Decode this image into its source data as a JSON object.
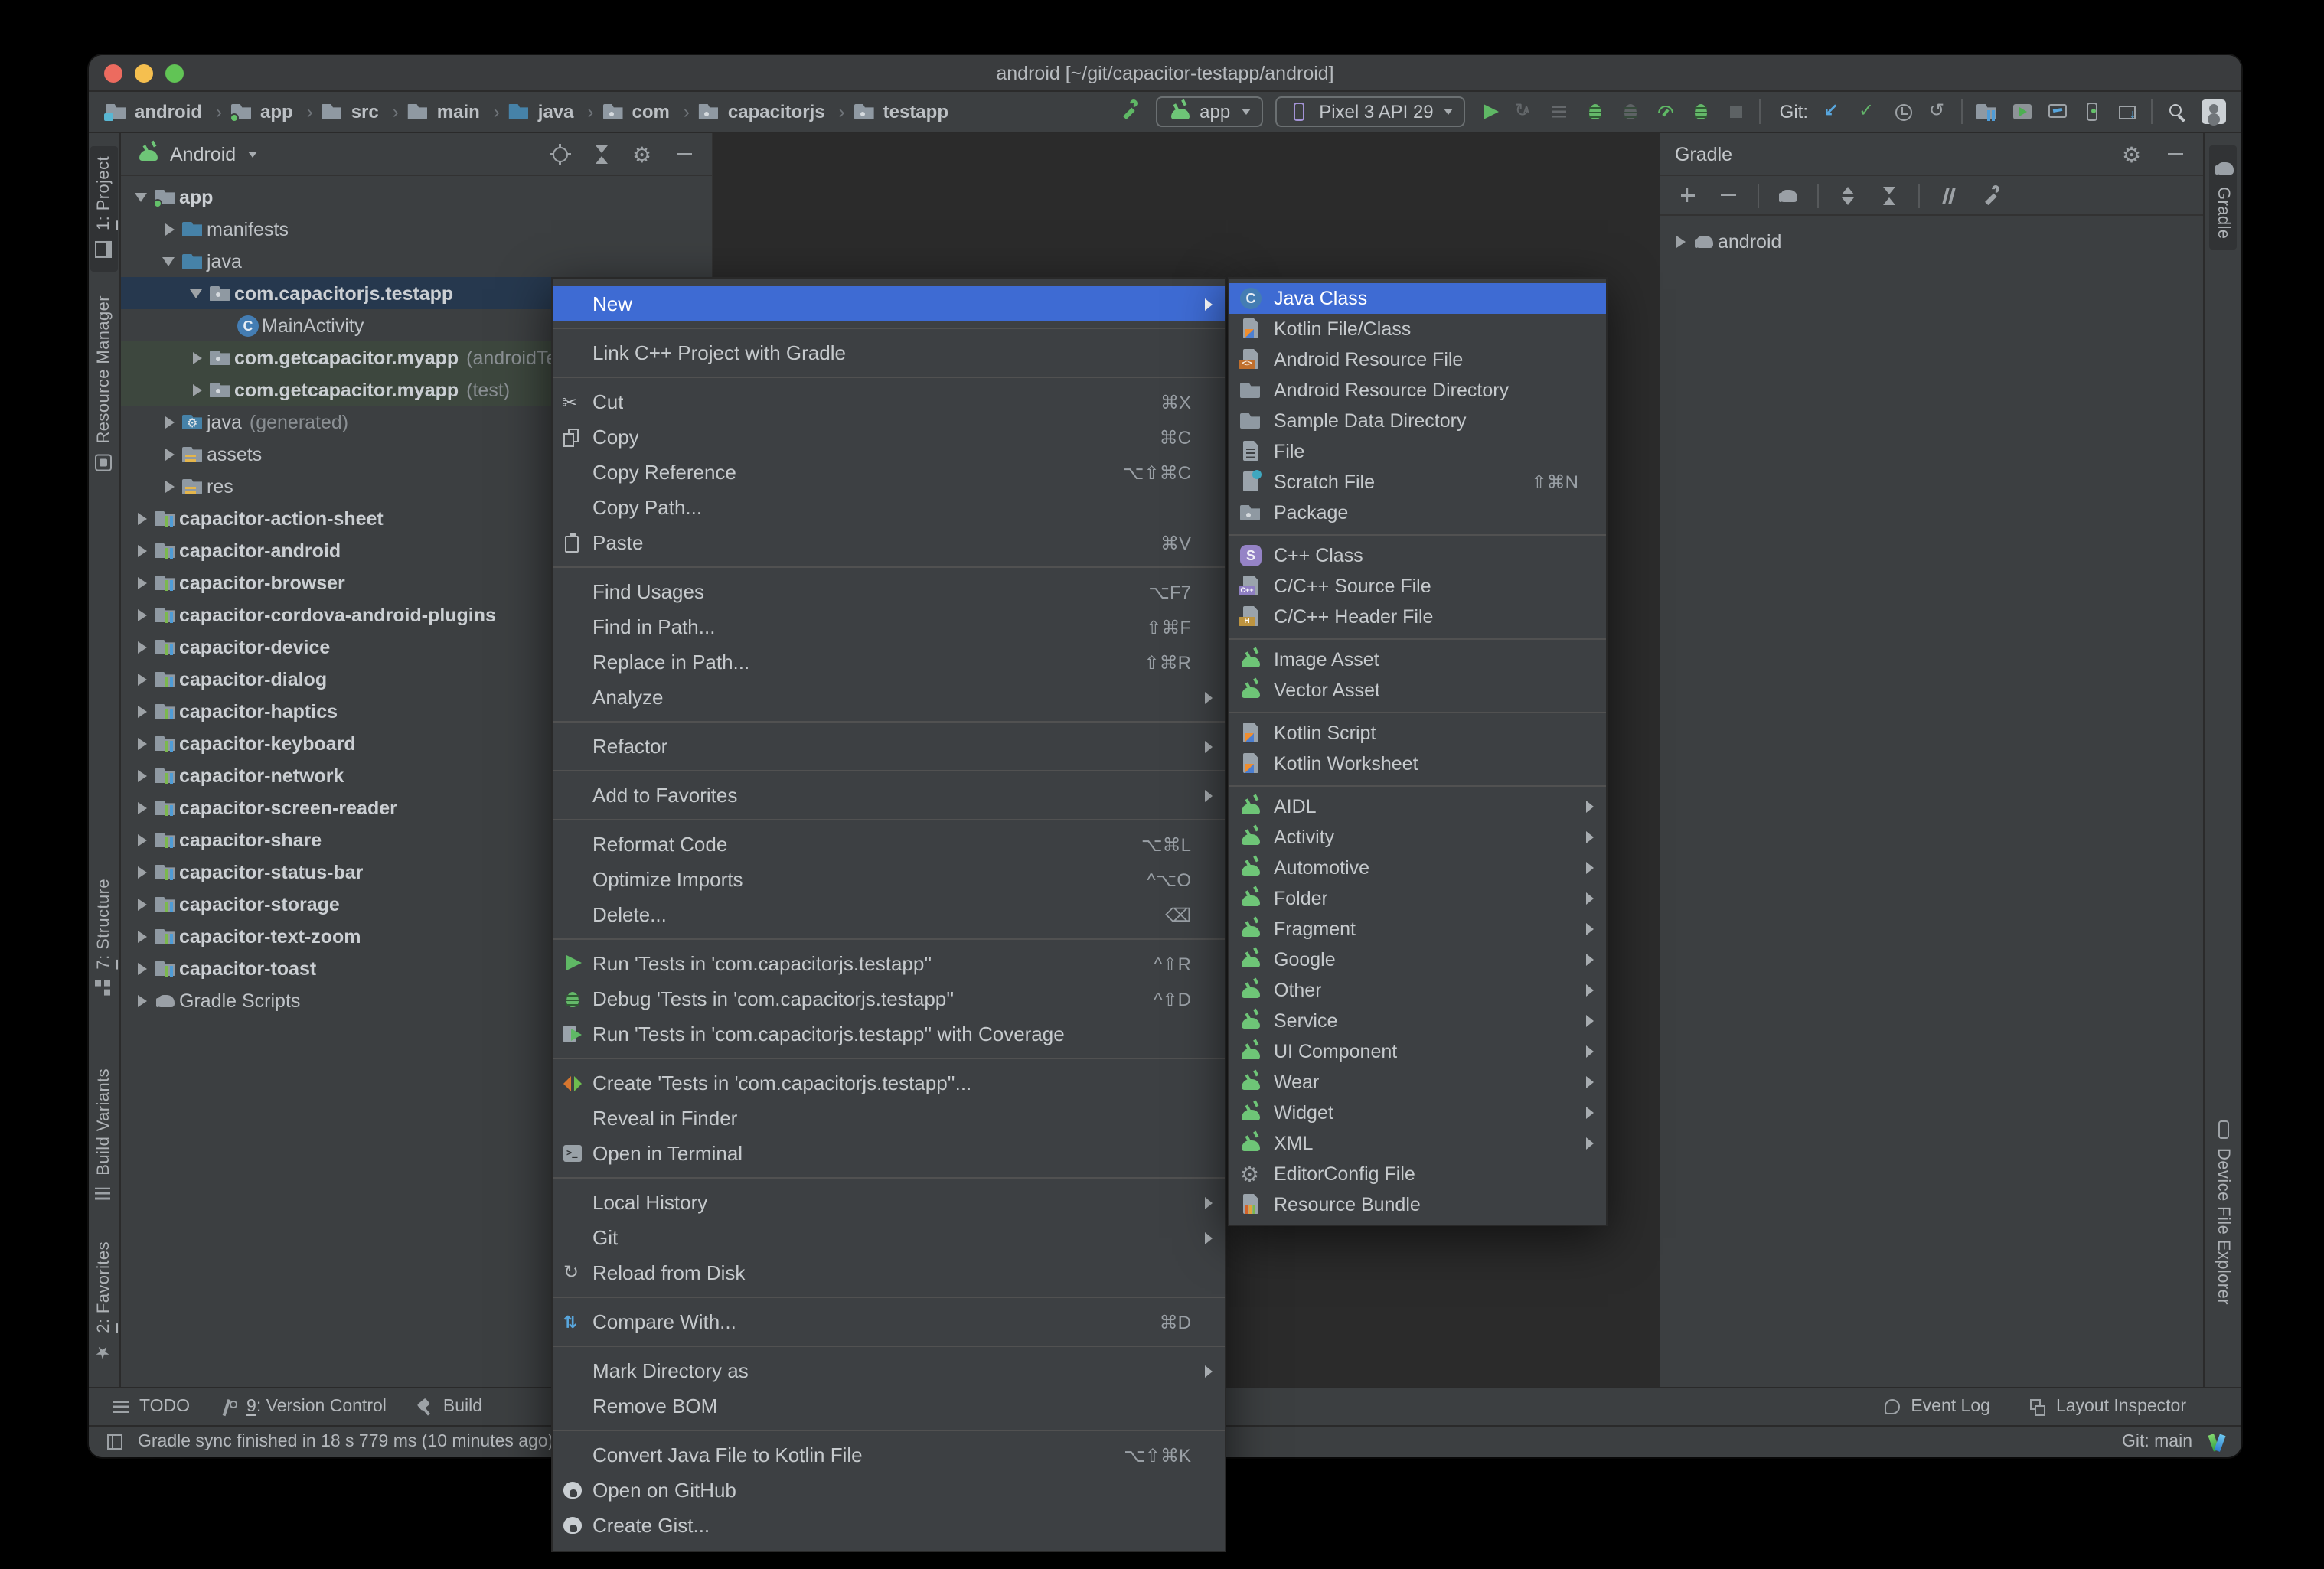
{
  "window": {
    "title": "android [~/git/capacitor-testapp/android]"
  },
  "breadcrumbs": {
    "separator": "›",
    "items": [
      {
        "label": "android",
        "icon": "project-folder-icon"
      },
      {
        "label": "app",
        "icon": "app-folder-icon"
      },
      {
        "label": "src",
        "icon": "folder-icon"
      },
      {
        "label": "main",
        "icon": "folder-icon"
      },
      {
        "label": "java",
        "icon": "folder-blue-icon"
      },
      {
        "label": "com",
        "icon": "package-icon"
      },
      {
        "label": "capacitorjs",
        "icon": "package-icon"
      },
      {
        "label": "testapp",
        "icon": "package-icon"
      }
    ]
  },
  "toolbar": {
    "run_config": {
      "label": "app"
    },
    "device": {
      "label": "Pixel 3 API 29"
    },
    "run_icons": [
      {
        "icon": "run-button-icon"
      },
      {
        "icon": "apply-changes-icon",
        "disabled": true
      },
      {
        "icon": "apply-code-changes-icon",
        "disabled": true
      },
      {
        "icon": "debug-button-icon"
      },
      {
        "icon": "attach-debugger-icon",
        "disabled": true
      },
      {
        "icon": "profiler-button-icon"
      },
      {
        "icon": "profile-app-icon"
      },
      {
        "icon": "stop-button-icon",
        "disabled": true
      },
      {
        "icon": "toolbar-divider"
      }
    ],
    "git_label": "Git:",
    "git_icons": [
      {
        "icon": "update-project-icon"
      },
      {
        "icon": "commit-icon"
      },
      {
        "icon": "history-icon"
      },
      {
        "icon": "rollback-icon"
      },
      {
        "icon": "toolbar-divider"
      }
    ],
    "tool_icons": [
      {
        "icon": "device-manager-icon"
      },
      {
        "icon": "logcat-icon"
      },
      {
        "icon": "app-inspection-icon"
      },
      {
        "icon": "running-devices-icon"
      },
      {
        "icon": "sdk-manager-icon"
      },
      {
        "icon": "toolbar-divider"
      }
    ]
  },
  "project_panel": {
    "view": "Android",
    "header_icons": [
      {
        "icon": "locate-icon"
      },
      {
        "icon": "collapse-all-icon"
      },
      {
        "icon": "settings-gear-icon"
      },
      {
        "icon": "hide-panel-icon"
      }
    ],
    "tree": [
      {
        "label": "app",
        "icon": "app-folder-icon",
        "chevron": "expanded",
        "level": 0,
        "bold": true
      },
      {
        "label": "manifests",
        "icon": "folder-blue-icon",
        "chevron": "collapsed",
        "level": 1
      },
      {
        "label": "java",
        "icon": "folder-blue-icon",
        "chevron": "expanded",
        "level": 1
      },
      {
        "label": "com.capacitorjs.testapp",
        "icon": "package-icon",
        "chevron": "expanded",
        "level": 2,
        "bold": true,
        "selected": true
      },
      {
        "label": "MainActivity",
        "icon": "class-icon",
        "level": 3
      },
      {
        "label": "com.getcapacitor.myapp",
        "suffix": "(androidTest)",
        "icon": "package-icon",
        "chevron": "collapsed",
        "level": 2,
        "bold": true,
        "tint": true
      },
      {
        "label": "com.getcapacitor.myapp",
        "suffix": "(test)",
        "icon": "package-icon",
        "chevron": "collapsed",
        "level": 2,
        "bold": true,
        "tint": true
      },
      {
        "label": "java",
        "suffix": "(generated)",
        "icon": "gen-folder-icon",
        "chevron": "collapsed",
        "level": 1
      },
      {
        "label": "assets",
        "icon": "res-folder-icon",
        "chevron": "collapsed",
        "level": 1
      },
      {
        "label": "res",
        "icon": "res-folder-icon",
        "chevron": "collapsed",
        "level": 1
      },
      {
        "label": "capacitor-action-sheet",
        "icon": "module-icon",
        "chevron": "collapsed",
        "level": 0,
        "bold": true
      },
      {
        "label": "capacitor-android",
        "icon": "module-icon",
        "chevron": "collapsed",
        "level": 0,
        "bold": true
      },
      {
        "label": "capacitor-browser",
        "icon": "module-icon",
        "chevron": "collapsed",
        "level": 0,
        "bold": true
      },
      {
        "label": "capacitor-cordova-android-plugins",
        "icon": "module-icon",
        "chevron": "collapsed",
        "level": 0,
        "bold": true
      },
      {
        "label": "capacitor-device",
        "icon": "module-icon",
        "chevron": "collapsed",
        "level": 0,
        "bold": true
      },
      {
        "label": "capacitor-dialog",
        "icon": "module-icon",
        "chevron": "collapsed",
        "level": 0,
        "bold": true
      },
      {
        "label": "capacitor-haptics",
        "icon": "module-icon",
        "chevron": "collapsed",
        "level": 0,
        "bold": true
      },
      {
        "label": "capacitor-keyboard",
        "icon": "module-icon",
        "chevron": "collapsed",
        "level": 0,
        "bold": true
      },
      {
        "label": "capacitor-network",
        "icon": "module-icon",
        "chevron": "collapsed",
        "level": 0,
        "bold": true
      },
      {
        "label": "capacitor-screen-reader",
        "icon": "module-icon",
        "chevron": "collapsed",
        "level": 0,
        "bold": true
      },
      {
        "label": "capacitor-share",
        "icon": "module-icon",
        "chevron": "collapsed",
        "level": 0,
        "bold": true
      },
      {
        "label": "capacitor-status-bar",
        "icon": "module-icon",
        "chevron": "collapsed",
        "level": 0,
        "bold": true
      },
      {
        "label": "capacitor-storage",
        "icon": "module-icon",
        "chevron": "collapsed",
        "level": 0,
        "bold": true
      },
      {
        "label": "capacitor-text-zoom",
        "icon": "module-icon",
        "chevron": "collapsed",
        "level": 0,
        "bold": true
      },
      {
        "label": "capacitor-toast",
        "icon": "module-icon",
        "chevron": "collapsed",
        "level": 0,
        "bold": true
      },
      {
        "label": "Gradle Scripts",
        "icon": "gradle-elephant-icon",
        "chevron": "collapsed",
        "level": 0
      }
    ]
  },
  "context_menu": {
    "items": [
      {
        "label": "New",
        "selected": true,
        "arrow": true
      },
      {
        "sep": true
      },
      {
        "label": "Link C++ Project with Gradle"
      },
      {
        "sep": true
      },
      {
        "label": "Cut",
        "icon": "scissors-icon",
        "shortcut": "⌘X"
      },
      {
        "label": "Copy",
        "icon": "copy-icon",
        "shortcut": "⌘C"
      },
      {
        "label": "Copy Reference",
        "shortcut": "⌥⇧⌘C"
      },
      {
        "label": "Copy Path..."
      },
      {
        "label": "Paste",
        "icon": "paste-icon",
        "shortcut": "⌘V"
      },
      {
        "sep": true
      },
      {
        "label": "Find Usages",
        "shortcut": "⌥F7"
      },
      {
        "label": "Find in Path...",
        "shortcut": "⇧⌘F"
      },
      {
        "label": "Replace in Path...",
        "shortcut": "⇧⌘R"
      },
      {
        "label": "Analyze",
        "arrow": true
      },
      {
        "sep": true
      },
      {
        "label": "Refactor",
        "arrow": true
      },
      {
        "sep": true
      },
      {
        "label": "Add to Favorites",
        "arrow": true
      },
      {
        "sep": true
      },
      {
        "label": "Reformat Code",
        "shortcut": "⌥⌘L"
      },
      {
        "label": "Optimize Imports",
        "shortcut": "^⌥O"
      },
      {
        "label": "Delete...",
        "shortcut": "⌫"
      },
      {
        "sep": true
      },
      {
        "label": "Run 'Tests in 'com.capacitorjs.testapp''",
        "icon": "run-play-icon",
        "shortcut": "^⇧R"
      },
      {
        "label": "Debug 'Tests in 'com.capacitorjs.testapp''",
        "icon": "debug-bug-icon",
        "shortcut": "^⇧D"
      },
      {
        "label": "Run 'Tests in 'com.capacitorjs.testapp'' with Coverage",
        "icon": "coverage-icon"
      },
      {
        "sep": true
      },
      {
        "label": "Create 'Tests in 'com.capacitorjs.testapp''...",
        "icon": "create-tests-icon"
      },
      {
        "label": "Reveal in Finder"
      },
      {
        "label": "Open in Terminal",
        "icon": "terminal-icon"
      },
      {
        "sep": true
      },
      {
        "label": "Local History",
        "arrow": true
      },
      {
        "label": "Git",
        "arrow": true
      },
      {
        "label": "Reload from Disk",
        "icon": "reload-icon"
      },
      {
        "sep": true
      },
      {
        "label": "Compare With...",
        "icon": "compare-icon",
        "shortcut": "⌘D"
      },
      {
        "sep": true
      },
      {
        "label": "Mark Directory as",
        "arrow": true
      },
      {
        "label": "Remove BOM"
      },
      {
        "sep": true
      },
      {
        "label": "Convert Java File to Kotlin File",
        "shortcut": "⌥⇧⌘K"
      },
      {
        "label": "Open on GitHub",
        "icon": "github-icon"
      },
      {
        "label": "Create Gist...",
        "icon": "github-icon"
      }
    ]
  },
  "new_submenu": {
    "items": [
      {
        "label": "Java Class",
        "icon": "java-class-icon",
        "selected": true
      },
      {
        "label": "Kotlin File/Class",
        "icon": "kotlin-file-icon"
      },
      {
        "label": "Android Resource File",
        "icon": "android-resource-file-icon"
      },
      {
        "label": "Android Resource Directory",
        "icon": "folder-icon"
      },
      {
        "label": "Sample Data Directory",
        "icon": "folder-icon"
      },
      {
        "label": "File",
        "icon": "file-icon"
      },
      {
        "label": "Scratch File",
        "icon": "scratch-file-icon",
        "shortcut": "⇧⌘N"
      },
      {
        "label": "Package",
        "icon": "package-icon"
      },
      {
        "sep": true
      },
      {
        "label": "C++ Class",
        "icon": "cpp-class-icon"
      },
      {
        "label": "C/C++ Source File",
        "icon": "cpp-source-icon"
      },
      {
        "label": "C/C++ Header File",
        "icon": "cpp-header-icon"
      },
      {
        "sep": true
      },
      {
        "label": "Image Asset",
        "icon": "android-head-icon"
      },
      {
        "label": "Vector Asset",
        "icon": "android-head-icon"
      },
      {
        "sep": true
      },
      {
        "label": "Kotlin Script",
        "icon": "kotlin-script-icon"
      },
      {
        "label": "Kotlin Worksheet",
        "icon": "kotlin-script-icon"
      },
      {
        "sep": true
      },
      {
        "label": "AIDL",
        "icon": "android-head-icon",
        "arrow": true
      },
      {
        "label": "Activity",
        "icon": "android-head-icon",
        "arrow": true
      },
      {
        "label": "Automotive",
        "icon": "android-head-icon",
        "arrow": true
      },
      {
        "label": "Folder",
        "icon": "android-head-icon",
        "arrow": true
      },
      {
        "label": "Fragment",
        "icon": "android-head-icon",
        "arrow": true
      },
      {
        "label": "Google",
        "icon": "android-head-icon",
        "arrow": true
      },
      {
        "label": "Other",
        "icon": "android-head-icon",
        "arrow": true
      },
      {
        "label": "Service",
        "icon": "android-head-icon",
        "arrow": true
      },
      {
        "label": "UI Component",
        "icon": "android-head-icon",
        "arrow": true
      },
      {
        "label": "Wear",
        "icon": "android-head-icon",
        "arrow": true
      },
      {
        "label": "Widget",
        "icon": "android-head-icon",
        "arrow": true
      },
      {
        "label": "XML",
        "icon": "android-head-icon",
        "arrow": true
      },
      {
        "label": "EditorConfig File",
        "icon": "settings-gear-icon"
      },
      {
        "label": "Resource Bundle",
        "icon": "resource-bundle-icon"
      }
    ]
  },
  "gradle_panel": {
    "title": "Gradle",
    "header_icons": [
      {
        "icon": "settings-gear-icon"
      },
      {
        "icon": "hide-panel-icon"
      }
    ],
    "toolbar_icons": [
      {
        "icon": "plus-icon"
      },
      {
        "icon": "minus-icon"
      },
      {
        "icon": "toolbar-divider"
      },
      {
        "icon": "gradle-sync-icon"
      },
      {
        "icon": "toolbar-divider"
      },
      {
        "icon": "expand-all-icon"
      },
      {
        "icon": "collapse-all-icon"
      },
      {
        "icon": "toolbar-divider"
      },
      {
        "icon": "toggle-offline-icon"
      },
      {
        "icon": "wrench-icon"
      }
    ],
    "tree": [
      {
        "label": "android"
      }
    ]
  },
  "left_stripe": {
    "tabs": [
      {
        "label": "1: Project",
        "icon": "project-tab-icon",
        "active": true,
        "mnemonic": true
      },
      {
        "label": "Resource Manager",
        "icon": "resource-manager-icon"
      },
      {
        "label": "7: Structure",
        "icon": "structure-tab-icon",
        "mnemonic": true
      },
      {
        "label": "Build Variants",
        "icon": "build-variants-icon"
      },
      {
        "label": "2: Favorites",
        "icon": "favorites-star-icon",
        "mnemonic": true
      }
    ]
  },
  "right_stripe": {
    "tabs": [
      {
        "label": "Gradle",
        "icon": "gradle-elephant-icon",
        "active": true
      },
      {
        "label": "Device File Explorer",
        "icon": "device-explorer-icon"
      }
    ]
  },
  "toolwindow_bar": {
    "left": [
      {
        "label": "TODO",
        "icon": "todo-list-icon"
      },
      {
        "label": "9: Version Control",
        "icon": "version-control-icon",
        "mnemonic": true
      },
      {
        "label": "Build",
        "icon": "build-hammer-icon"
      }
    ],
    "right": [
      {
        "label": "Event Log",
        "icon": "event-log-icon"
      },
      {
        "label": "Layout Inspector",
        "icon": "layout-inspector-icon"
      }
    ]
  },
  "status_bar": {
    "message": "Gradle sync finished in 18 s 779 ms (10 minutes ago)",
    "git_branch": "Git: main"
  }
}
